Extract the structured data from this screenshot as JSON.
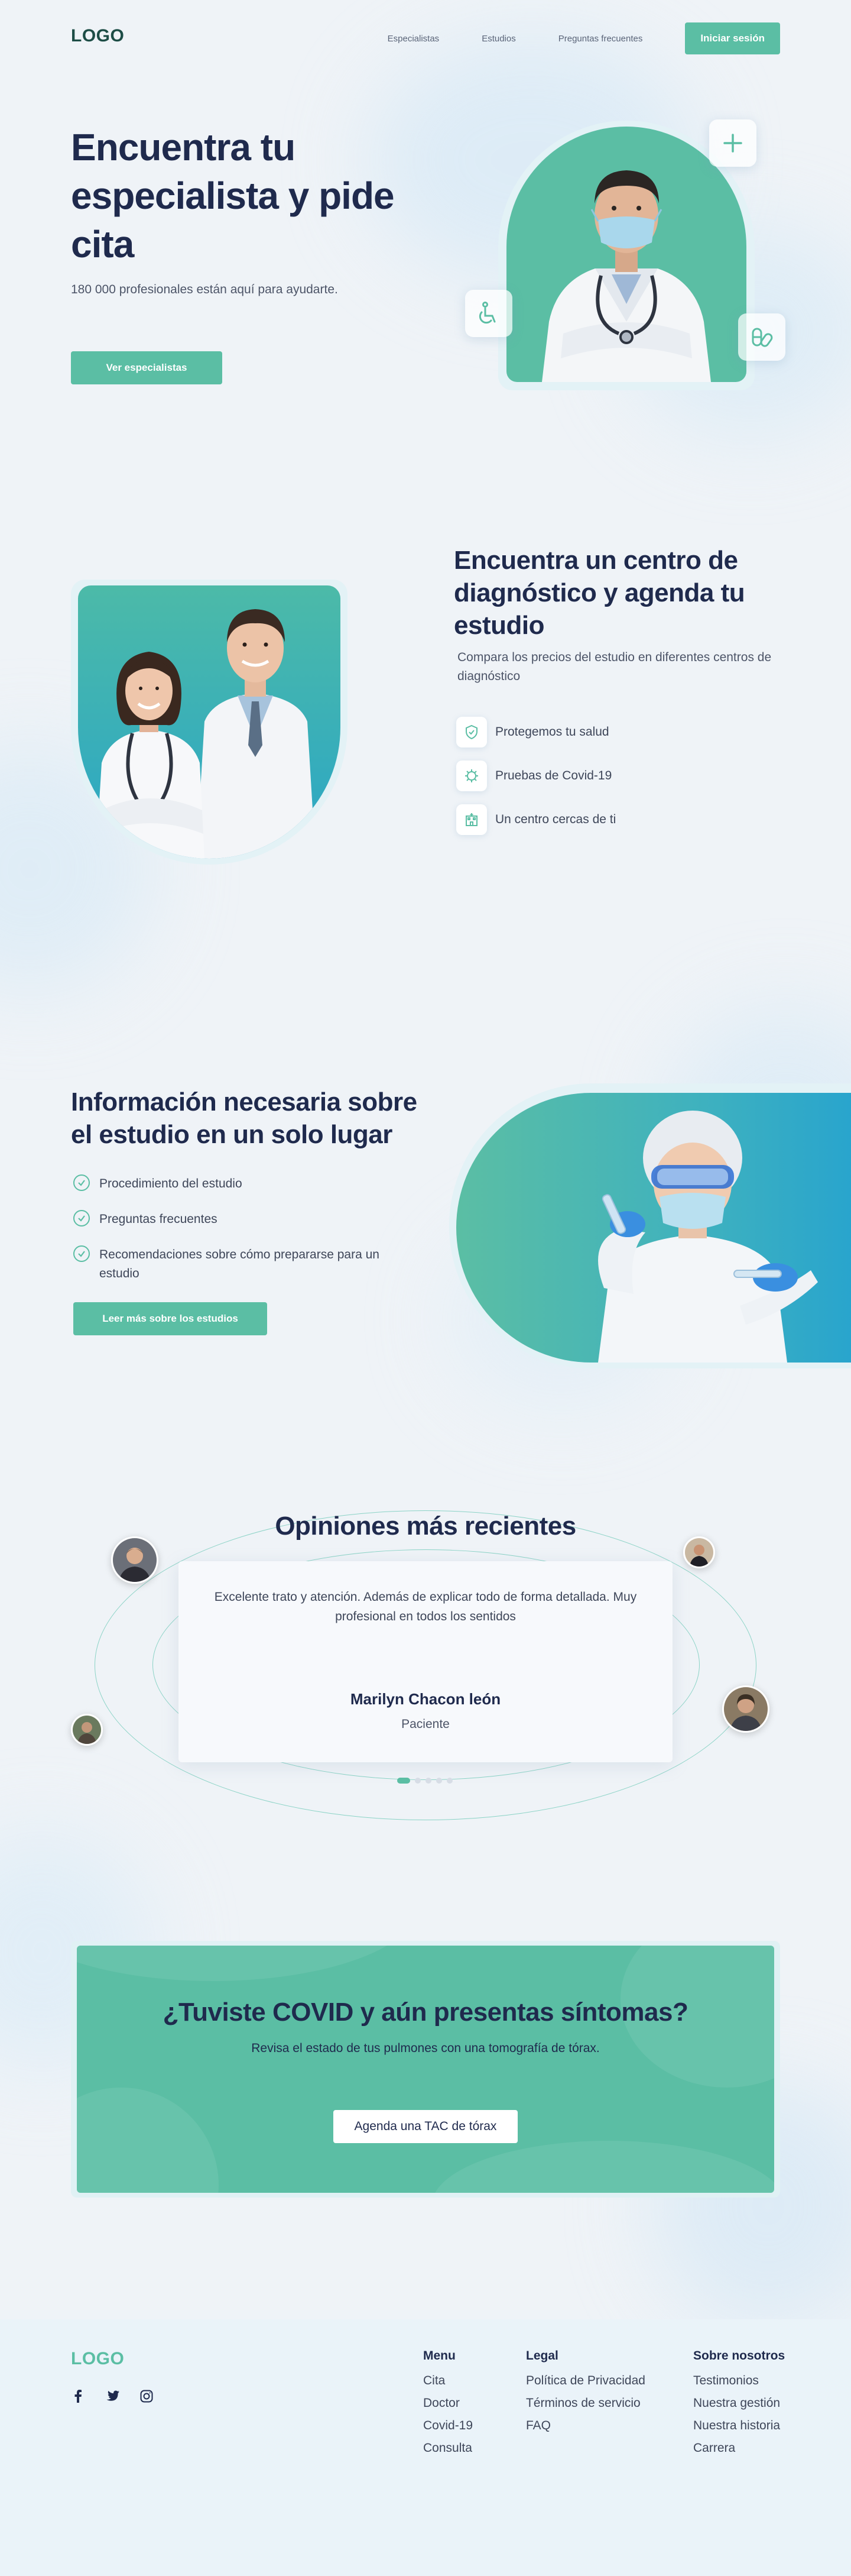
{
  "header": {
    "logo": "LOGO",
    "nav": [
      "Especialistas",
      "Estudios",
      "Preguntas frecuentes"
    ],
    "login": "Iniciar sesión"
  },
  "hero": {
    "title": "Encuentra tu especialista y pide cita",
    "subtitle": "180 000 profesionales están aquí para ayudarte.",
    "button": "Ver especialistas"
  },
  "diagnostic": {
    "title": "Encuentra un centro de diagnóstico y agenda tu estudio",
    "subtitle": "Compara los precios del estudio en diferentes centros de diagnóstico",
    "features": [
      "Protegemos tu salud",
      "Pruebas de Covid-19",
      "Un centro cercas de ti"
    ]
  },
  "info": {
    "title": "Información necesaria sobre el estudio en un solo lugar",
    "items": [
      "Procedimiento del estudio",
      "Preguntas frecuentes",
      "Recomendaciones sobre cómo prepararse para un estudio"
    ],
    "button": "Leer más sobre los estudios"
  },
  "reviews": {
    "title": "Opiniones más recientes",
    "text": "Excelente trato y atención. Además de explicar todo de forma detallada. Muy profesional en todos los sentidos",
    "name": "Marilyn Chacon león",
    "role": "Paciente",
    "active_slide": 1,
    "slide_count": 5
  },
  "covid": {
    "title": "¿Tuviste COVID y aún presentas síntomas?",
    "subtitle": "Revisa el estado de tus pulmones con una tomografía de tórax.",
    "button": "Agenda una TAC de tórax"
  },
  "footer": {
    "logo": "LOGO",
    "social": [
      "facebook-icon",
      "twitter-icon",
      "instagram-icon"
    ],
    "columns": [
      {
        "title": "Menu",
        "links": [
          "Cita",
          "Doctor",
          "Covid-19",
          "Consulta"
        ]
      },
      {
        "title": "Legal",
        "links": [
          "Política de Privacidad",
          "Términos de servicio",
          "FAQ"
        ]
      },
      {
        "title": "Sobre nosotros",
        "links": [
          "Testimonios",
          "Nuestra gestión",
          "Nuestra historia",
          "Carrera"
        ]
      }
    ]
  },
  "colors": {
    "accent": "#5bbea4",
    "navy": "#1f2a4d",
    "background": "#eff3f7"
  }
}
